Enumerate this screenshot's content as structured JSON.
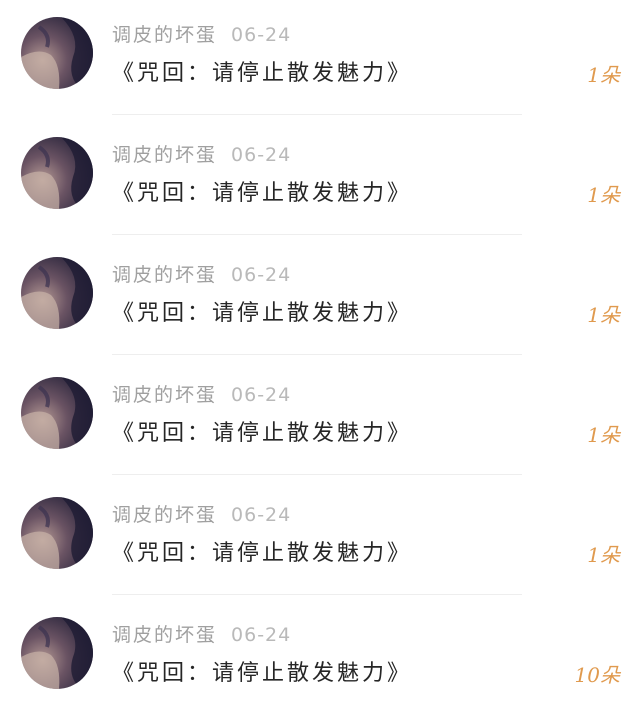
{
  "list": {
    "rows": [
      {
        "username": "调皮的坏蛋",
        "date": "06-24",
        "title": "《咒回：请停止散发魅力》",
        "count": "1朵"
      },
      {
        "username": "调皮的坏蛋",
        "date": "06-24",
        "title": "《咒回：请停止散发魅力》",
        "count": "1朵"
      },
      {
        "username": "调皮的坏蛋",
        "date": "06-24",
        "title": "《咒回：请停止散发魅力》",
        "count": "1朵"
      },
      {
        "username": "调皮的坏蛋",
        "date": "06-24",
        "title": "《咒回：请停止散发魅力》",
        "count": "1朵"
      },
      {
        "username": "调皮的坏蛋",
        "date": "06-24",
        "title": "《咒回：请停止散发魅力》",
        "count": "1朵"
      },
      {
        "username": "调皮的坏蛋",
        "date": "06-24",
        "title": "《咒回：请停止散发魅力》",
        "count": "10朵"
      }
    ]
  },
  "colors": {
    "meta": "#a3a3a3",
    "title": "#262626",
    "count_accent": "#e09a4e"
  },
  "icons": {
    "avatar": "user-avatar-image"
  }
}
